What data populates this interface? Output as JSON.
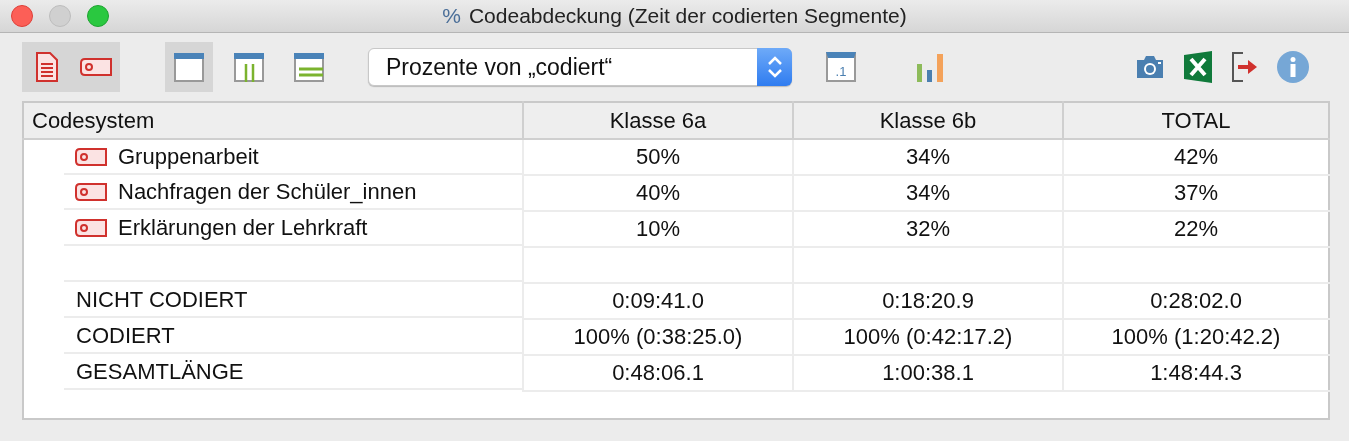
{
  "window": {
    "title_icon": "%",
    "title": "Codeabdeckung (Zeit der codierten Segmente)"
  },
  "toolbar": {
    "source_buttons": [
      {
        "kind": "document",
        "selected": true
      },
      {
        "kind": "code",
        "selected": true
      }
    ],
    "layout_buttons": [
      {
        "kind": "window",
        "selected": true
      },
      {
        "kind": "columns",
        "selected": false
      },
      {
        "kind": "rows",
        "selected": false
      }
    ],
    "dropdown": {
      "value": "Prozente von „codiert“"
    },
    "decimals_label": ".1",
    "right_buttons": [
      {
        "kind": "camera"
      },
      {
        "kind": "excel"
      },
      {
        "kind": "export"
      },
      {
        "kind": "info"
      }
    ]
  },
  "table": {
    "columns": [
      "Codesystem",
      "Klasse 6a",
      "Klasse 6b",
      "TOTAL"
    ],
    "rows": [
      {
        "kind": "code",
        "label": "Gruppenarbeit",
        "values": [
          "50%",
          "34%",
          "42%"
        ]
      },
      {
        "kind": "code",
        "label": "Nachfragen der Schüler_innen",
        "values": [
          "40%",
          "34%",
          "37%"
        ]
      },
      {
        "kind": "code",
        "label": "Erklärungen der Lehrkraft",
        "values": [
          "10%",
          "32%",
          "22%"
        ]
      },
      {
        "kind": "blank"
      },
      {
        "kind": "summary",
        "label": "NICHT CODIERT",
        "values": [
          "0:09:41.0",
          "0:18:20.9",
          "0:28:02.0"
        ]
      },
      {
        "kind": "summary",
        "label": "CODIERT",
        "values": [
          "100% (0:38:25.0)",
          "100% (0:42:17.2)",
          "100% (1:20:42.2)"
        ]
      },
      {
        "kind": "summary",
        "label": "GESAMTLÄNGE",
        "values": [
          "0:48:06.1",
          "1:00:38.1",
          "1:48:44.3"
        ]
      }
    ]
  }
}
